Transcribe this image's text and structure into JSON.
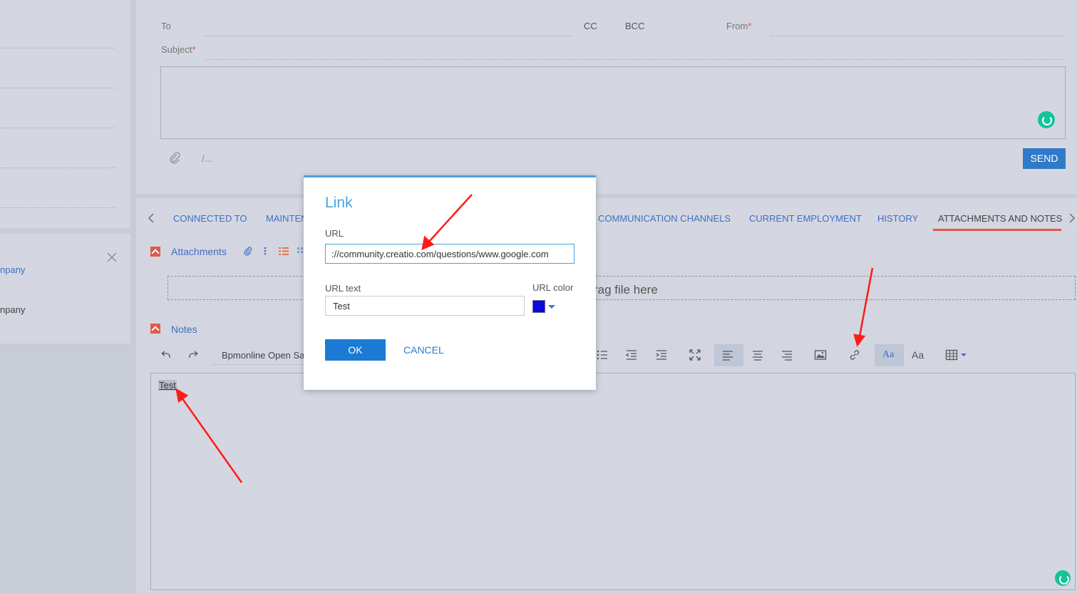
{
  "email": {
    "to_label": "To",
    "cc_label": "CC",
    "bcc_label": "BCC",
    "from_label": "From",
    "subject_label": "Subject",
    "required_mark": "*",
    "template_placeholder": "/...",
    "send_label": "SEND"
  },
  "left_card": {
    "line1": "npany",
    "line2": "npany"
  },
  "tabs": [
    {
      "label": "CONNECTED TO"
    },
    {
      "label": "MAINTEN"
    },
    {
      "label": "COMMUNICATION CHANNELS"
    },
    {
      "label": "CURRENT EMPLOYMENT"
    },
    {
      "label": "HISTORY"
    },
    {
      "label": "ATTACHMENTS AND NOTES",
      "active": true
    }
  ],
  "attachments": {
    "title": "Attachments",
    "dropzone_text": "rag file here"
  },
  "notes": {
    "title": "Notes",
    "font_name": "Bpmonline Open Sa",
    "editor_text": "Test"
  },
  "toolbar": {
    "aa_serif": "Aa",
    "aa_sans": "Aa"
  },
  "link_dialog": {
    "title": "Link",
    "url_label": "URL",
    "url_value": "://community.creatio.com/questions/www.google.com",
    "url_text_label": "URL text",
    "url_text_value": "Test",
    "url_color_label": "URL color",
    "url_color": "#0a0adb",
    "ok_label": "OK",
    "cancel_label": "CANCEL"
  },
  "colors": {
    "accent": "#2f7ac9",
    "tab_active": "#e1584b",
    "annotation_arrow": "#ff0000"
  }
}
